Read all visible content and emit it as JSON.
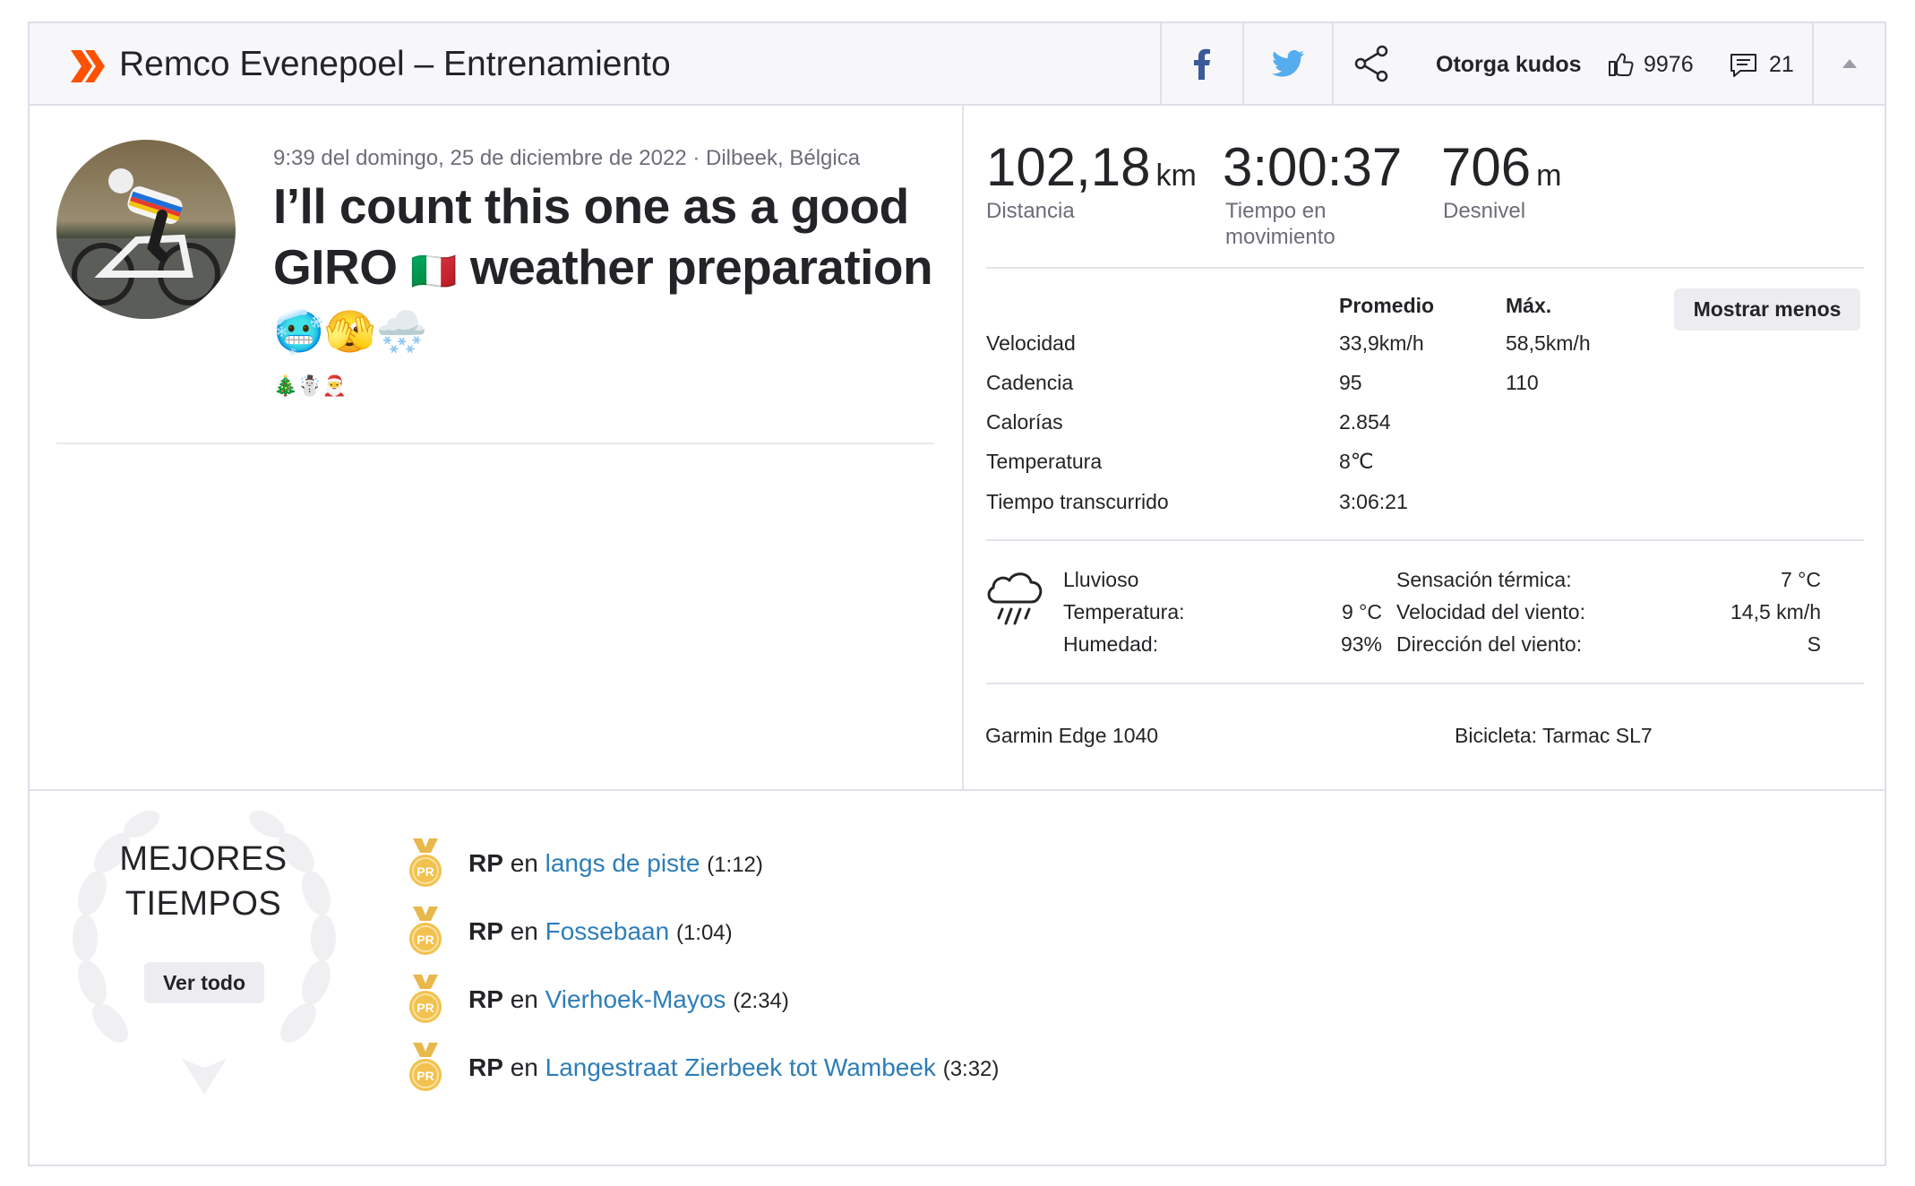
{
  "header": {
    "title": "Remco Evenepoel – Entrenamiento",
    "give_kudos": "Otorga kudos",
    "kudos_count": "9976",
    "comments_count": "21"
  },
  "activity": {
    "meta": "9:39 del domingo, 25 de diciembre de 2022 · Dilbeek, Bélgica",
    "title_line1": "I’ll count this one as a good",
    "title_line2_a": "GIRO",
    "title_flag": "🇮🇹",
    "title_line2_b": "weather preparation",
    "title_emojis": "🥶🫣🌨️",
    "small_emojis": "🎄☃️🎅"
  },
  "stats": {
    "distance": {
      "value": "102,18",
      "unit": "km",
      "label": "Distancia"
    },
    "moving_time": {
      "value": "3:00:37",
      "label": "Tiempo en movimiento"
    },
    "elevation": {
      "value": "706",
      "unit": "m",
      "label": "Desnivel"
    },
    "col_avg": "Promedio",
    "col_max": "Máx.",
    "show_less": "Mostrar menos",
    "rows": [
      {
        "label": "Velocidad",
        "avg": "33,9km/h",
        "max": "58,5km/h"
      },
      {
        "label": "Cadencia",
        "avg": "95",
        "max": "110"
      },
      {
        "label": "Calorías",
        "avg": "2.854",
        "max": ""
      },
      {
        "label": "Temperatura",
        "avg": "8℃",
        "max": ""
      },
      {
        "label": "Tiempo transcurrido",
        "avg": "3:06:21",
        "max": ""
      }
    ]
  },
  "weather": {
    "condition": "Lluvioso",
    "temp_label": "Temperatura:",
    "temp_value": "9 °C",
    "humidity_label": "Humedad:",
    "humidity_value": "93%",
    "feels_label": "Sensación térmica:",
    "feels_value": "7 °C",
    "wind_speed_label": "Velocidad del viento:",
    "wind_speed_value": "14,5 km/h",
    "wind_dir_label": "Dirección del viento:",
    "wind_dir_value": "S"
  },
  "gear": {
    "device": "Garmin Edge 1040",
    "bike": "Bicicleta: Tarmac SL7"
  },
  "best_efforts": {
    "title": "MEJORES TIEMPOS",
    "view_all": "Ver todo",
    "medal_label": "PR",
    "items": [
      {
        "badge": "RP",
        "en": "en",
        "segment": "langs de piste",
        "time": "(1:12)"
      },
      {
        "badge": "RP",
        "en": "en",
        "segment": "Fossebaan",
        "time": "(1:04)"
      },
      {
        "badge": "RP",
        "en": "en",
        "segment": "Vierhoek-Mayos",
        "time": "(2:34)"
      },
      {
        "badge": "RP",
        "en": "en",
        "segment": "Langestraat Zierbeek tot Wambeek",
        "time": "(3:32)"
      }
    ]
  },
  "colors": {
    "brand": "#fc5200",
    "link": "#2d7eb8",
    "facebook": "#3b5998",
    "twitter": "#55acee",
    "medal": "#f2c14e"
  }
}
